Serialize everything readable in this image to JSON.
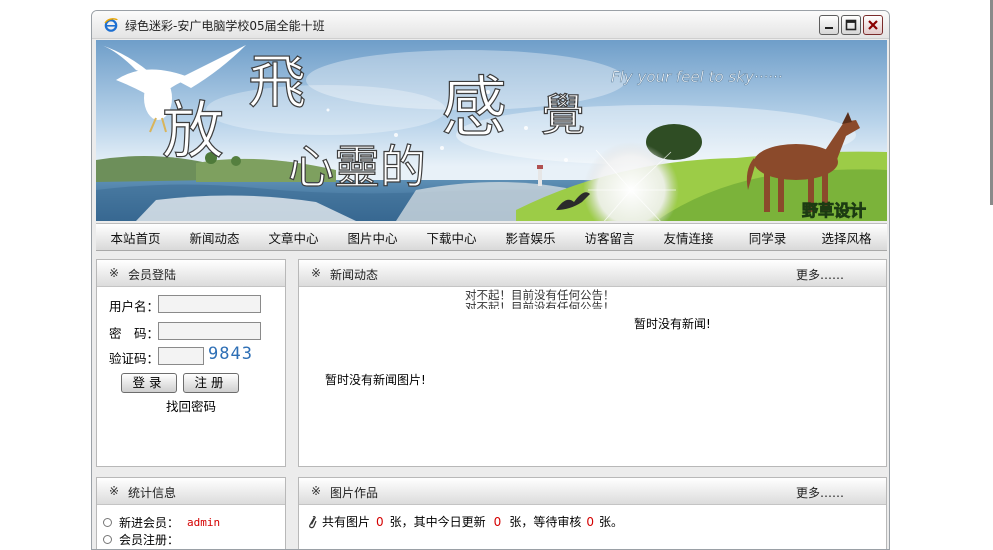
{
  "window": {
    "title": "绿色迷彩-安广电脑学校05届全能十班"
  },
  "banner": {
    "big_chars": [
      "放",
      "飛",
      "感",
      "覺"
    ],
    "sub_text": "心靈的",
    "slogan": "Fly  your  feel to sky······",
    "designer": "野草设计"
  },
  "nav": {
    "items": [
      "本站首页",
      "新闻动态",
      "文章中心",
      "图片中心",
      "下载中心",
      "影音娱乐",
      "访客留言",
      "友情连接",
      "同学录",
      "选择风格"
    ]
  },
  "login": {
    "mark": "※",
    "title": "会员登陆",
    "username_label": "用户名：",
    "password_label": "密　码：",
    "captcha_label": "验证码：",
    "captcha_value": "9843",
    "login_button": "登录",
    "register_button": "注册",
    "forgot_link": "找回密码"
  },
  "news": {
    "mark": "※",
    "title": "新闻动态",
    "more": "更多……",
    "notice_line": "对不起！目前没有任何公告！",
    "no_news": "暂时没有新闻!",
    "no_news_images": "暂时没有新闻图片!"
  },
  "stats": {
    "mark": "※",
    "title": "统计信息",
    "new_member_label": "新进会员：",
    "new_member_value": "admin",
    "member_reg_label": "会员注册："
  },
  "photos": {
    "mark": "※",
    "title": "图片作品",
    "more": "更多……",
    "summary_prefix": "共有图片",
    "total": "0",
    "summary_mid1": "张，其中今日更新",
    "today": "0",
    "summary_mid2": "张，等待审核",
    "pending": "0",
    "summary_suffix": "张。"
  },
  "colors": {
    "accent_red": "#d40000",
    "panel_border": "#b8b8b8"
  }
}
